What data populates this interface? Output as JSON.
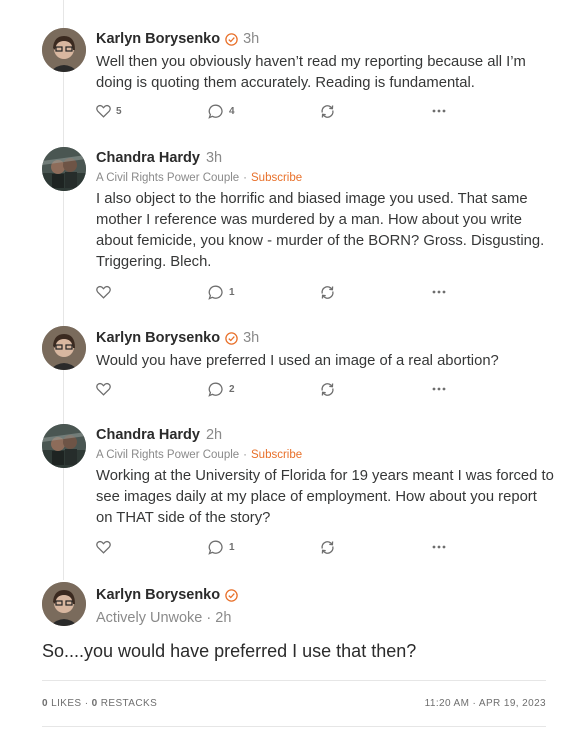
{
  "comments": [
    {
      "author": "Karlyn Borysenko",
      "verified": true,
      "time": "3h",
      "publication": "",
      "subscribe": "",
      "text": "Well then you obviously haven’t read my reporting because all I’m doing is quoting them accurately. Reading is fundamental.",
      "likes": "5",
      "replies": "4"
    },
    {
      "author": "Chandra Hardy",
      "verified": false,
      "time": "3h",
      "publication": "A Civil Rights Power Couple",
      "subscribe": "Subscribe",
      "text": "I also object to the horrific and biased image you used. That same mother I reference was murdered by a man. How about you write about femicide, you know - murder of the BORN? Gross. Disgusting. Triggering. Blech.",
      "likes": "",
      "replies": "1"
    },
    {
      "author": "Karlyn Borysenko",
      "verified": true,
      "time": "3h",
      "publication": "",
      "subscribe": "",
      "text": "Would you have preferred I used an image of a real abortion?",
      "likes": "",
      "replies": "2"
    },
    {
      "author": "Chandra Hardy",
      "verified": false,
      "time": "2h",
      "publication": "A Civil Rights Power Couple",
      "subscribe": "Subscribe",
      "text": "Working at the University of Florida for 19 years meant I was forced to see images daily at my place of employment. How about you report on THAT side of the story?",
      "likes": "",
      "replies": "1"
    }
  ],
  "focused": {
    "author": "Karlyn Borysenko",
    "publication": "Actively Unwoke",
    "time": "2h",
    "text": "So....you would have preferred I use that then?"
  },
  "footer": {
    "likes_count": "0",
    "likes_label": "LIKES",
    "restacks_count": "0",
    "restacks_label": "RESTACKS",
    "time": "11:20 AM",
    "date": "APR 19, 2023"
  },
  "separator": "·",
  "colors": {
    "accent": "#e8702a",
    "muted": "#8a8a8a",
    "text": "#363737"
  },
  "icons": [
    "heart-icon",
    "comment-icon",
    "restack-icon",
    "more-icon",
    "verified-check-icon"
  ]
}
